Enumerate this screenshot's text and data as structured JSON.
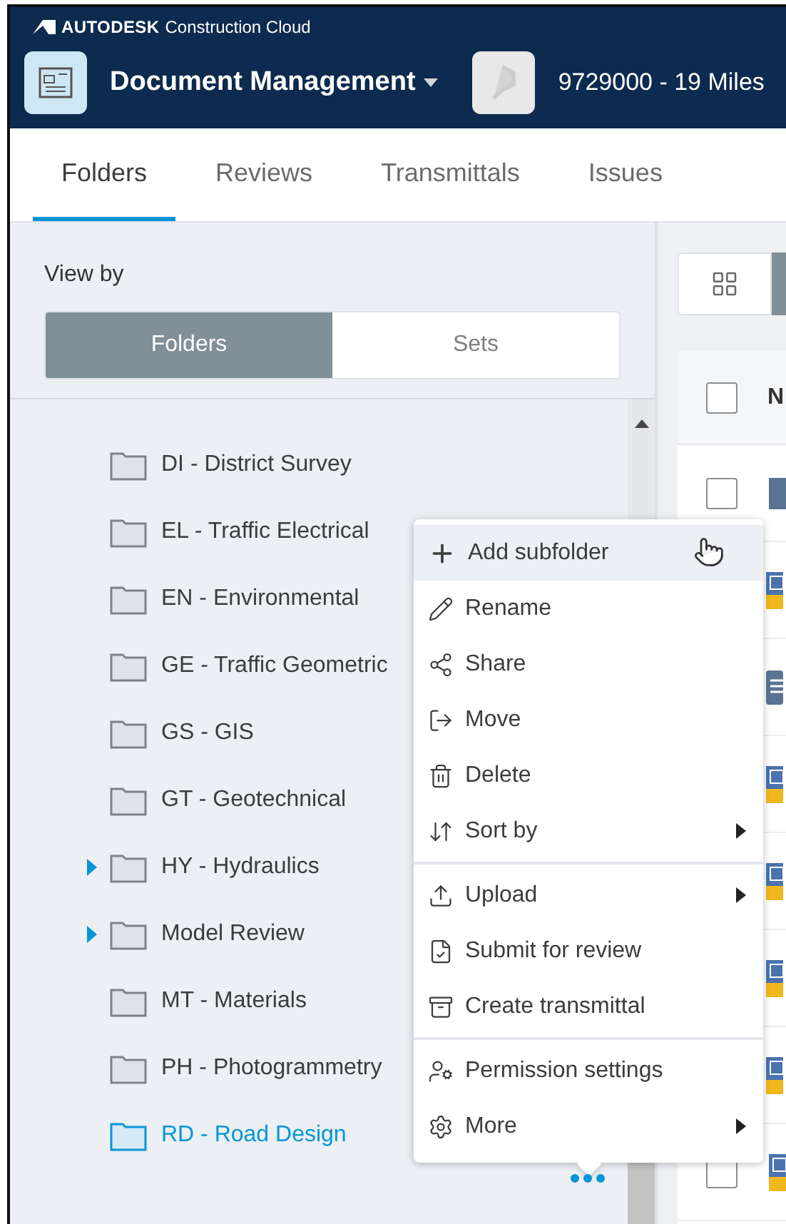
{
  "header": {
    "brand": "AUTODESK",
    "product": "Construction Cloud",
    "module": "Document Management",
    "project": "9729000 - 19 Miles"
  },
  "tabs": [
    {
      "label": "Folders",
      "selected": true
    },
    {
      "label": "Reviews",
      "selected": false
    },
    {
      "label": "Transmittals",
      "selected": false
    },
    {
      "label": "Issues",
      "selected": false
    }
  ],
  "view_by": {
    "label": "View by",
    "options": [
      {
        "label": "Folders",
        "selected": true
      },
      {
        "label": "Sets",
        "selected": false
      }
    ]
  },
  "folders": [
    {
      "name": "DI - District Survey",
      "expandable": false,
      "selected": false
    },
    {
      "name": "EL - Traffic Electrical",
      "expandable": false,
      "selected": false
    },
    {
      "name": "EN - Environmental",
      "expandable": false,
      "selected": false
    },
    {
      "name": "GE - Traffic Geometric",
      "expandable": false,
      "selected": false
    },
    {
      "name": "GS - GIS",
      "expandable": false,
      "selected": false
    },
    {
      "name": "GT - Geotechnical",
      "expandable": false,
      "selected": false
    },
    {
      "name": "HY - Hydraulics",
      "expandable": true,
      "selected": false
    },
    {
      "name": "Model Review",
      "expandable": true,
      "selected": false
    },
    {
      "name": "MT - Materials",
      "expandable": false,
      "selected": false
    },
    {
      "name": "PH - Photogrammetry",
      "expandable": false,
      "selected": false
    },
    {
      "name": "RD - Road Design",
      "expandable": false,
      "selected": true
    }
  ],
  "context_menu": [
    [
      {
        "label": "Add subfolder",
        "submenu": false,
        "hovered": true
      },
      {
        "label": "Rename",
        "submenu": false,
        "hovered": false
      },
      {
        "label": "Share",
        "submenu": false,
        "hovered": false
      },
      {
        "label": "Move",
        "submenu": false,
        "hovered": false
      },
      {
        "label": "Delete",
        "submenu": false,
        "hovered": false
      },
      {
        "label": "Sort by",
        "submenu": true,
        "hovered": false
      }
    ],
    [
      {
        "label": "Upload",
        "submenu": true,
        "hovered": false
      },
      {
        "label": "Submit for review",
        "submenu": false,
        "hovered": false
      },
      {
        "label": "Create transmittal",
        "submenu": false,
        "hovered": false
      }
    ],
    [
      {
        "label": "Permission settings",
        "submenu": false,
        "hovered": false
      },
      {
        "label": "More",
        "submenu": true,
        "hovered": false
      }
    ]
  ],
  "table": {
    "column_1": "N",
    "select_all_checked": false,
    "rows": [
      {
        "kind": "folder",
        "checked": false
      },
      {
        "kind": "drawing"
      },
      {
        "kind": "document"
      },
      {
        "kind": "drawing"
      },
      {
        "kind": "drawing"
      },
      {
        "kind": "drawing"
      },
      {
        "kind": "drawing"
      },
      {
        "kind": "drawing",
        "checked": false
      }
    ]
  }
}
